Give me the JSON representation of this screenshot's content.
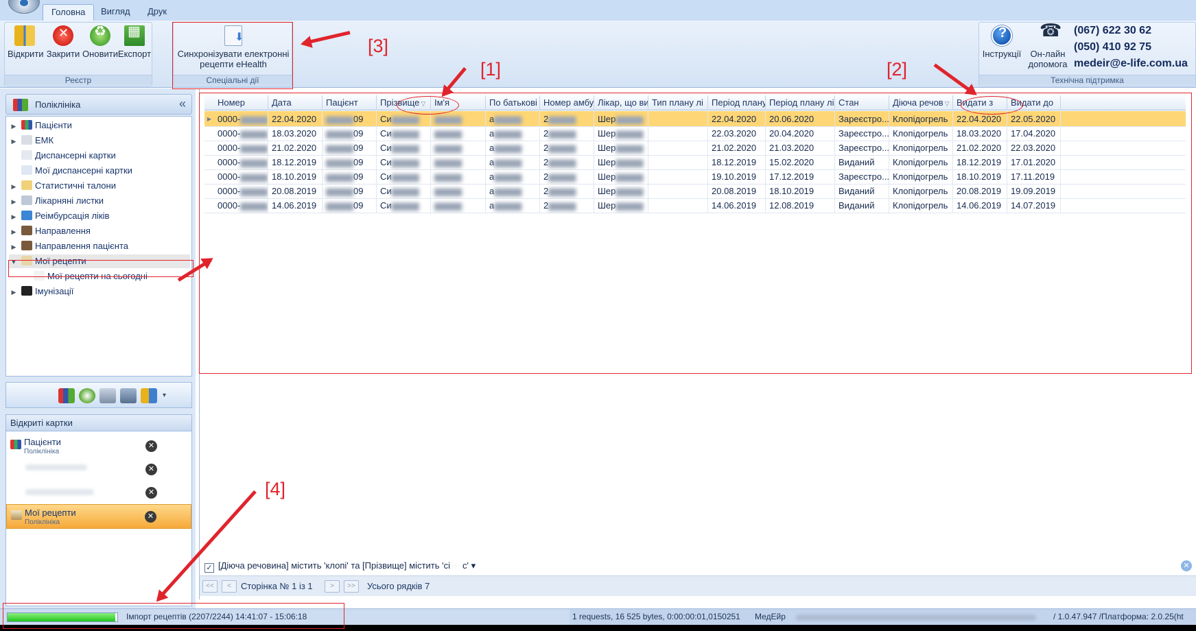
{
  "ribbon": {
    "tabs": [
      "Головна",
      "Вигляд",
      "Друк"
    ],
    "groups": {
      "registry": {
        "label": "Реєстр",
        "buttons": [
          "Відкрити",
          "Закрити",
          "Оновити",
          "Експорт"
        ]
      },
      "special": {
        "label": "Спеціальні дії",
        "sync_line1": "Синхронізувати електронні",
        "sync_line2": "рецепти eHealth"
      },
      "support": {
        "label": "Технічна підтримка",
        "help": "Інструкції",
        "online_line1": "Он-лайн",
        "online_line2": "допомога"
      }
    },
    "contacts": {
      "phone1": "(067) 622 30 62",
      "phone2": "(050) 410 92 75",
      "email": "medeir@e-life.com.ua"
    }
  },
  "annotations": [
    "[1]",
    "[2]",
    "[3]",
    "[4]"
  ],
  "nav": {
    "title": "Поліклініка",
    "collapse": "«",
    "tree": [
      {
        "label": "Пацієнти",
        "icon": "patients-icon",
        "expander": "▶",
        "indent": 0
      },
      {
        "label": "ЕМК",
        "icon": "emk-icon",
        "expander": "▶",
        "indent": 0
      },
      {
        "label": "Диспансерні картки",
        "icon": "dispensary-icon",
        "expander": "",
        "indent": 0
      },
      {
        "label": "Мої диспансерні картки",
        "icon": "my-dispensary-icon",
        "expander": "",
        "indent": 0
      },
      {
        "label": "Статистичні талони",
        "icon": "stat-coupon-icon",
        "expander": "▶",
        "indent": 0
      },
      {
        "label": "Лікарняні листки",
        "icon": "sick-leave-icon",
        "expander": "▶",
        "indent": 0
      },
      {
        "label": "Реімбурсація ліків",
        "icon": "reimbursement-icon",
        "expander": "▶",
        "indent": 0
      },
      {
        "label": "Направлення",
        "icon": "referral-icon",
        "expander": "▶",
        "indent": 0
      },
      {
        "label": "Направлення пацієнта",
        "icon": "patient-referral-icon",
        "expander": "▶",
        "indent": 0
      },
      {
        "label": "Мої рецепти",
        "icon": "prescriptions-icon",
        "expander": "▼",
        "indent": 0
      },
      {
        "label": "Мої рецепти на сьогодні",
        "icon": "today-prescriptions-icon",
        "expander": "",
        "indent": 1
      },
      {
        "label": "Імунізації",
        "icon": "immunization-icon",
        "expander": "▶",
        "indent": 0
      }
    ]
  },
  "open_cards": {
    "title": "Відкриті картки",
    "cards": [
      {
        "title": "Пацієнти",
        "sub": "Поліклініка"
      },
      {
        "title": "Мої рецепти",
        "sub": "Поліклініка"
      }
    ]
  },
  "grid": {
    "columns": [
      "Номер",
      "Дата",
      "Пацієнт",
      "Прізвище",
      "Ім'я",
      "По батькові",
      "Номер амбул",
      "Лікар, що ви",
      "Тип плану лі",
      "Період плану",
      "Період плану лік",
      "Стан",
      "Діюча речов",
      "Видати з",
      "Видати до"
    ],
    "rows": [
      {
        "num": "0000-",
        "date": "22.04.2020",
        "patient": "09",
        "surname": "Си",
        "name": "",
        "patronymic": "а",
        "amb": "2",
        "doctor": "Шер",
        "plan_type": "",
        "period_from": "22.04.2020",
        "period_to": "20.06.2020",
        "state": "Зареєстро...",
        "substance": "Клопідогрель",
        "issue_from": "22.04.2020",
        "issue_to": "22.05.2020"
      },
      {
        "num": "0000-",
        "date": "18.03.2020",
        "patient": "09",
        "surname": "Си",
        "name": "",
        "patronymic": "а",
        "amb": "2",
        "doctor": "Шер",
        "plan_type": "",
        "period_from": "22.03.2020",
        "period_to": "20.04.2020",
        "state": "Зареєстро...",
        "substance": "Клопідогрель",
        "issue_from": "18.03.2020",
        "issue_to": "17.04.2020"
      },
      {
        "num": "0000-",
        "date": "21.02.2020",
        "patient": "09",
        "surname": "Си",
        "name": "",
        "patronymic": "а",
        "amb": "2",
        "doctor": "Шер",
        "plan_type": "",
        "period_from": "21.02.2020",
        "period_to": "21.03.2020",
        "state": "Зареєстро...",
        "substance": "Клопідогрель",
        "issue_from": "21.02.2020",
        "issue_to": "22.03.2020"
      },
      {
        "num": "0000-",
        "date": "18.12.2019",
        "patient": "09",
        "surname": "Си",
        "name": "",
        "patronymic": "а",
        "amb": "2",
        "doctor": "Шер",
        "plan_type": "",
        "period_from": "18.12.2019",
        "period_to": "15.02.2020",
        "state": "Виданий",
        "substance": "Клопідогрель",
        "issue_from": "18.12.2019",
        "issue_to": "17.01.2020"
      },
      {
        "num": "0000-",
        "date": "18.10.2019",
        "patient": "09",
        "surname": "Си",
        "name": "",
        "patronymic": "а",
        "amb": "2",
        "doctor": "Шер",
        "plan_type": "",
        "period_from": "19.10.2019",
        "period_to": "17.12.2019",
        "state": "Зареєстро...",
        "substance": "Клопідогрель",
        "issue_from": "18.10.2019",
        "issue_to": "17.11.2019"
      },
      {
        "num": "0000-",
        "date": "20.08.2019",
        "patient": "09",
        "surname": "Си",
        "name": "",
        "patronymic": "а",
        "amb": "2",
        "doctor": "Шер",
        "plan_type": "",
        "period_from": "20.08.2019",
        "period_to": "18.10.2019",
        "state": "Виданий",
        "substance": "Клопідогрель",
        "issue_from": "20.08.2019",
        "issue_to": "19.09.2019"
      },
      {
        "num": "0000-",
        "date": "14.06.2019",
        "patient": "09",
        "surname": "Си",
        "name": "",
        "patronymic": "а",
        "amb": "2",
        "doctor": "Шер",
        "plan_type": "",
        "period_from": "14.06.2019",
        "period_to": "12.08.2019",
        "state": "Виданий",
        "substance": "Клопідогрель",
        "issue_from": "14.06.2019",
        "issue_to": "14.07.2019"
      }
    ]
  },
  "filter": {
    "text": "[Діюча речовина] містить 'клопі' та [Прізвище] містить 'сі",
    "suffix": "с' ▾",
    "checkbox": "✓"
  },
  "pager": {
    "first": "<<",
    "prev": "<",
    "next": ">",
    "last": ">>",
    "page_text": "Сторінка № 1 із 1",
    "total": "Усього рядків 7"
  },
  "status": {
    "progress_fraction": 0.98,
    "import_text": "Імпорт рецептів (2207/2244) 14:41:07 - 15:06:18",
    "requests_text": "1 requests, 16 525 bytes, 0:00:00:01,0150251",
    "app_name": "МедЕйр",
    "version_text": "/ 1.0.47.947 /Платформа: 2.0.25(ht"
  },
  "colors": {
    "accent_red": "#e0242c",
    "selected_row": "#ffd675",
    "ribbon_bg": "#d4e3f5"
  }
}
